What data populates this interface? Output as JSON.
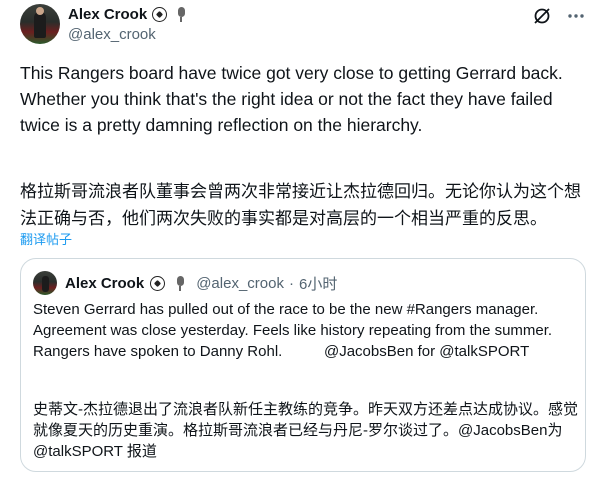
{
  "author": {
    "display_name": "Alex Crook",
    "handle": "@alex_crook",
    "badges": [
      "soccer-ball-icon",
      "microphone-icon"
    ]
  },
  "toolbar": {
    "icons": [
      "grok-icon",
      "more-options-icon"
    ]
  },
  "tweet": {
    "text": "This Rangers board have twice got very close to getting Gerrard back.\nWhether you think that's the right idea or not the fact they have failed\ntwice is a pretty damning reflection on the hierarchy.",
    "translation": "格拉斯哥流浪者队董事会曾两次非常接近让杰拉德回归。无论你认为这个想法正确与否，他们两次失败的事实都是对高层的一个相当严重的反思。",
    "translate_link": "翻译帖子"
  },
  "quote": {
    "display_name": "Alex Crook",
    "handle": "@alex_crook",
    "separator": "·",
    "time": "6小时",
    "lines": [
      "Steven Gerrard has pulled out of the race to be the new #Rangers manager.",
      "Agreement was close yesterday. Feels like history repeating from the summer.",
      "Rangers have spoken to Danny Rohl.          @JacobsBen for @talkSPORT"
    ],
    "translation": "史蒂文-杰拉德退出了流浪者队新任主教练的竞争。昨天双方还差点达成协议。感觉就像夏天的历史重演。格拉斯哥流浪者已经与丹尼-罗尔谈过了。@JacobsBen为 @talkSPORT 报道"
  },
  "colors": {
    "text": "#0f1419",
    "secondary": "#536471",
    "link": "#1d9bf0",
    "border": "#cfd9de"
  }
}
